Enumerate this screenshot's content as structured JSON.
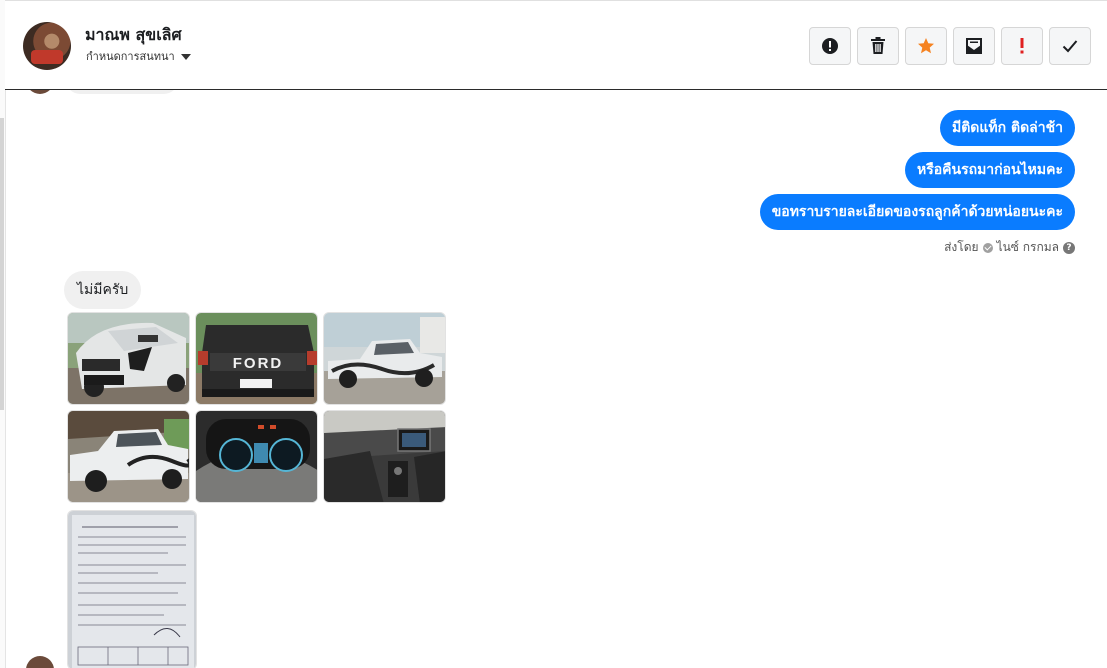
{
  "header": {
    "contact_name": "มาณพ สุขเลิศ",
    "assign_label": "กำหนดการสนทนา",
    "toolbar": {
      "spam_icon": "alert-circle-icon",
      "delete_icon": "trash-icon",
      "star_icon": "star-icon",
      "unread_icon": "envelope-icon",
      "follow_up_icon": "exclamation-icon",
      "done_icon": "check-icon"
    }
  },
  "colors": {
    "outgoing_bubble": "#0a7cff",
    "incoming_bubble": "#f0f0f0",
    "star": "#f58220",
    "follow_up": "#e02020"
  },
  "messages": {
    "outgoing": [
      "มีติดแท็ก ติดล่าช้า",
      "หรือคืนรถมาก่อนไหมคะ",
      "ขอทราบรายละเอียดของรถลูกค้าด้วยหน่อยนะคะ"
    ],
    "sent_by_prefix": "ส่งโดย",
    "sent_by_name": "ไนซ์ กรกมล",
    "incoming_text": "ไม่มีครับ"
  },
  "attachments": {
    "plate_text": "FORD",
    "photos": [
      {
        "name": "photo-white-pickup-front"
      },
      {
        "name": "photo-ford-tailgate"
      },
      {
        "name": "photo-pickup-side"
      },
      {
        "name": "photo-pickup-side-shade"
      },
      {
        "name": "photo-dashboard-gauges"
      },
      {
        "name": "photo-interior-console"
      },
      {
        "name": "photo-document"
      }
    ]
  }
}
